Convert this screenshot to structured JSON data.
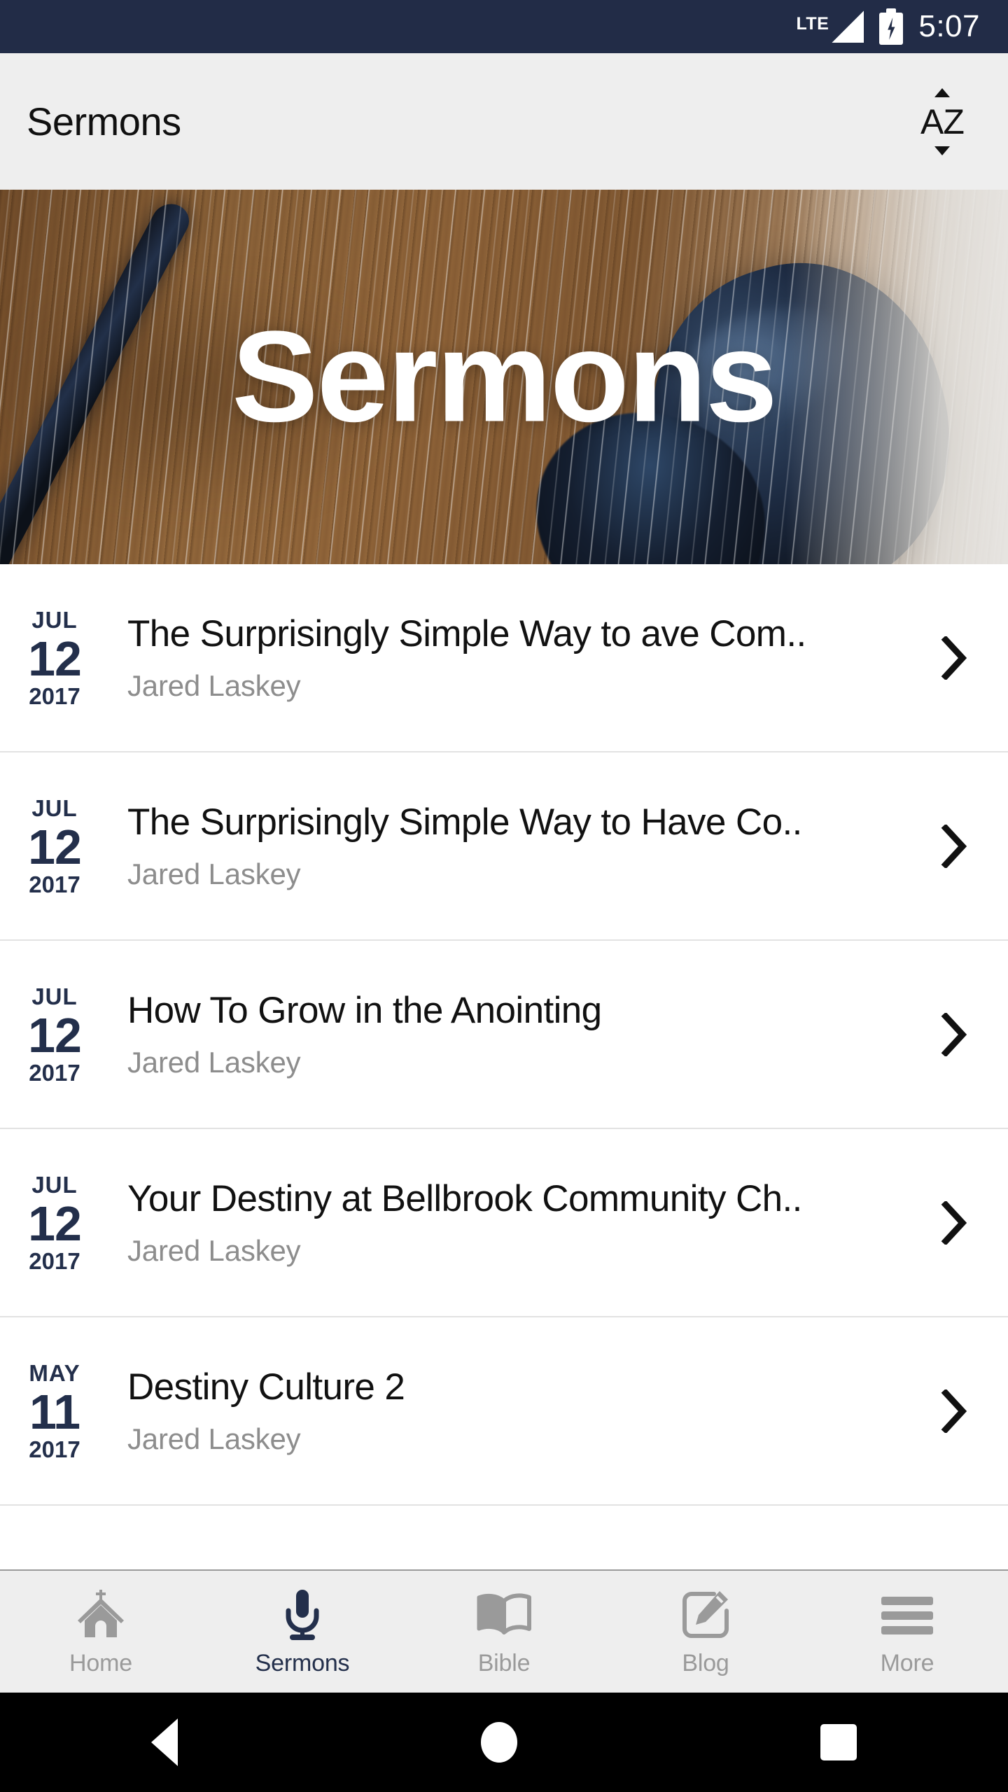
{
  "status_bar": {
    "network_label": "LTE",
    "time": "5:07",
    "battery_state": "charging",
    "background_color": "#222c47"
  },
  "header": {
    "title": "Sermons",
    "sort_button": {
      "label": "AZ",
      "name": "sort-az-button"
    },
    "background_color": "#eeeeee"
  },
  "hero": {
    "title": "Sermons",
    "description": "headphones on wooden surface with diagonal streak overlay"
  },
  "list": {
    "items": [
      {
        "month": "JUL",
        "day": "12",
        "year": "2017",
        "title": "The Surprisingly Simple Way to ave Com..",
        "author": "Jared Laskey"
      },
      {
        "month": "JUL",
        "day": "12",
        "year": "2017",
        "title": "The Surprisingly Simple Way to Have Co..",
        "author": "Jared Laskey"
      },
      {
        "month": "JUL",
        "day": "12",
        "year": "2017",
        "title": "How To Grow in the Anointing",
        "author": "Jared Laskey"
      },
      {
        "month": "JUL",
        "day": "12",
        "year": "2017",
        "title": "Your Destiny at Bellbrook Community Ch..",
        "author": "Jared Laskey"
      },
      {
        "month": "MAY",
        "day": "11",
        "year": "2017",
        "title": "Destiny Culture 2",
        "author": "Jared Laskey"
      }
    ],
    "date_color": "#232f4b",
    "title_color": "#111111",
    "author_color": "#8d8d8d"
  },
  "tabbar": {
    "active_index": 1,
    "active_color": "#232f4b",
    "inactive_color": "#9a9a9a",
    "tabs": [
      {
        "label": "Home",
        "icon": "church-icon"
      },
      {
        "label": "Sermons",
        "icon": "microphone-icon"
      },
      {
        "label": "Bible",
        "icon": "open-book-icon"
      },
      {
        "label": "Blog",
        "icon": "note-pencil-icon"
      },
      {
        "label": "More",
        "icon": "hamburger-menu-icon"
      }
    ]
  },
  "android_nav": {
    "back": "back-button",
    "home": "home-button",
    "recents": "recents-button"
  }
}
